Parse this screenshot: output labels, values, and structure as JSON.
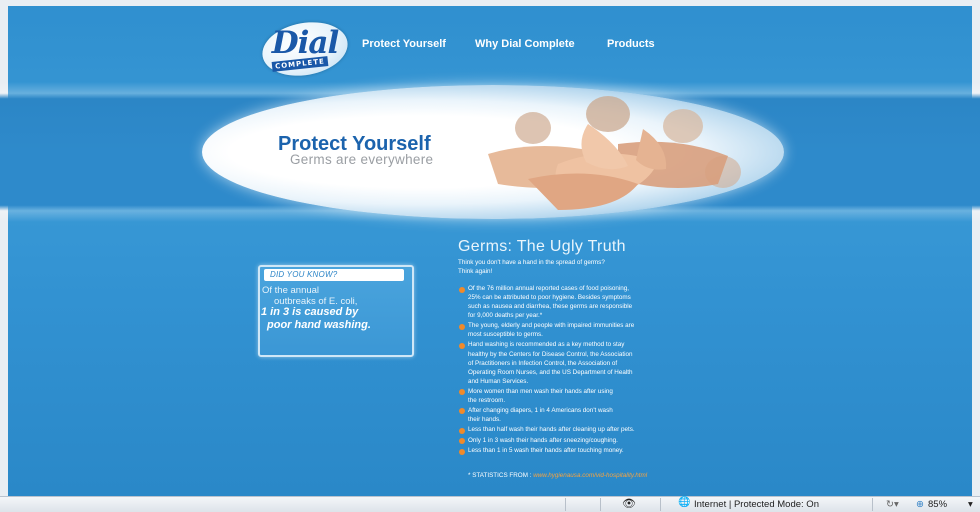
{
  "brand": {
    "logo_text": "Dial",
    "logo_sub": "COMPLETE"
  },
  "nav": [
    "Protect Yourself",
    "Why Dial Complete",
    "Products"
  ],
  "hero": {
    "title": "Protect Yourself",
    "subtitle": "Germs are everywhere"
  },
  "did_you_know": {
    "heading": "DID YOU KNOW?",
    "lines": [
      "Of the annual",
      "outbreaks of E. coli,"
    ],
    "bold_lines": [
      "1 in 3 is caused by",
      "poor hand washing."
    ]
  },
  "truth": {
    "title": "Germs: The Ugly Truth",
    "intro": [
      "Think you don't have a hand in the spread of germs?",
      "Think again!"
    ],
    "bullets": [
      [
        "Of the 76 million annual reported cases of food poisoning,",
        "25% can be attributed to poor hygiene. Besides symptoms",
        "such as nausea and diarrhea, these germs are responsible",
        "for 9,000 deaths per year.*"
      ],
      [
        "The young, elderly and people with impaired immunities are",
        "most susceptible to germs."
      ],
      [
        "Hand washing is recommended as a key method to stay",
        "healthy by the Centers for Disease Control, the Association",
        "of Practitioners in Infection Control, the Association of",
        "Operating Room Nurses, and the US Department of Health",
        "and Human Services."
      ],
      [
        "More women than men wash their hands after using",
        "the restroom."
      ],
      [
        "After changing diapers, 1 in 4 Americans don't wash",
        "their hands."
      ],
      [
        "Less than half wash their hands after cleaning up after pets."
      ],
      [
        "Only 1 in 3 wash their hands after sneezing/coughing."
      ],
      [
        "Less than 1 in 5 wash their hands after touching money."
      ]
    ],
    "stats_label": "* STATISTICS FROM :",
    "stats_url": "www.hygienausa.com/vid-hospitality.html"
  },
  "statusbar": {
    "zone": "Internet | Protected Mode: On",
    "zoom": "85%"
  },
  "colors": {
    "accent": "#1b63ad",
    "bullet": "#f08a2a",
    "background": "#3292d2"
  }
}
